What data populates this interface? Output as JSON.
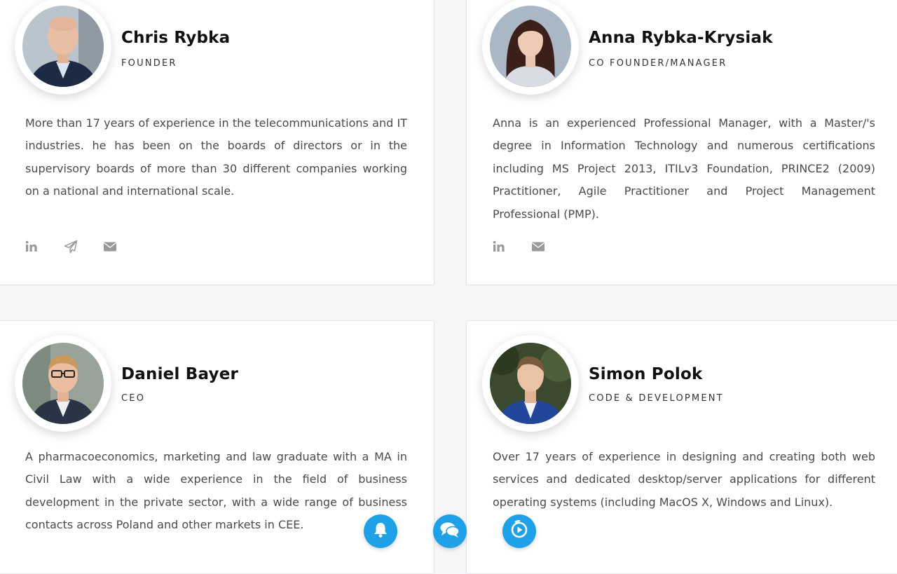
{
  "team": [
    {
      "name": "Chris Rybka",
      "role": "FOUNDER",
      "bio": "More than 17 years of experience in the telecommunications and IT industries. he has been on the boards of directors or in the supervisory boards of more than 30 different companies working on a national and international scale.",
      "social_icons": [
        "linkedin-icon",
        "paper-plane-icon",
        "envelope-icon"
      ]
    },
    {
      "name": "Anna Rybka-Krysiak",
      "role": "CO FOUNDER/MANAGER",
      "bio": "Anna is an experienced Professional Manager, with a Master/'s degree in Information Technology and numerous certifications including MS Project 2013, ITILv3 Foundation, PRINCE2 (2009) Practitioner, Agile Practitioner and Project Management Professional (PMP).",
      "social_icons": [
        "linkedin-icon",
        "envelope-icon"
      ]
    },
    {
      "name": "Daniel Bayer",
      "role": "CEO",
      "bio": "A pharmacoeconomics, marketing and law graduate with a MA in Civil Law with a wide experience in the field of business development in the private sector, with a wide range of business contacts across Poland and other markets in CEE."
    },
    {
      "name": "Simon Polok",
      "role": "CODE & DEVELOPMENT",
      "bio": "Over 17 years of experience in designing and creating both web services and dedicated desktop/server applications for different operating systems (including MacOS X, Windows and Linux)."
    }
  ],
  "floating_buttons": [
    "bell-icon",
    "chat-bubbles-icon",
    "play-circle-icon"
  ],
  "colors": {
    "accent": "#1ea1e6",
    "icon_gray": "#9a9a9a",
    "page_bg": "#f4f6f8"
  }
}
